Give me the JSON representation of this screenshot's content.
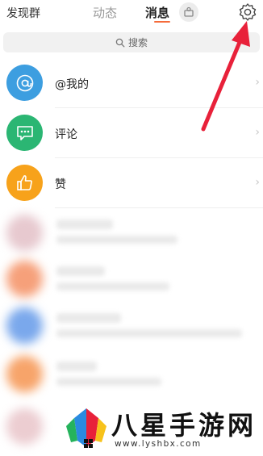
{
  "header": {
    "left_label": "发现群",
    "tabs": [
      {
        "label": "动态",
        "active": false
      },
      {
        "label": "消息",
        "active": true
      }
    ]
  },
  "search": {
    "placeholder": "搜索"
  },
  "messages": [
    {
      "label": "@我的",
      "icon": "at-icon",
      "color": "#3d9ee0"
    },
    {
      "label": "评论",
      "icon": "comment-icon",
      "color": "#2bb673"
    },
    {
      "label": "赞",
      "icon": "thumbs-up-icon",
      "color": "#f7a21b"
    }
  ],
  "colors": {
    "accent": "#f56b3a",
    "annotation_arrow": "#e8213a"
  },
  "watermark": {
    "title": "八星手游网",
    "url": "www.lyshbx.com"
  }
}
